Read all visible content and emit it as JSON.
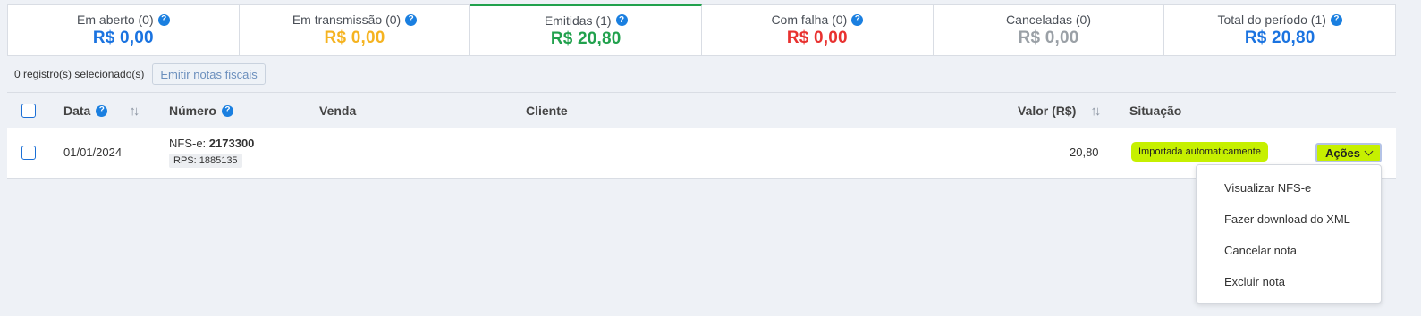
{
  "summary": {
    "cards": [
      {
        "label": "Em aberto (0)",
        "value": "R$ 0,00",
        "color": "#1a73e0",
        "help": true
      },
      {
        "label": "Em transmissão (0)",
        "value": "R$ 0,00",
        "color": "#f5b320",
        "help": true
      },
      {
        "label": "Emitidas (1)",
        "value": "R$ 20,80",
        "color": "#21a14d",
        "help": true
      },
      {
        "label": "Com falha (0)",
        "value": "R$ 0,00",
        "color": "#e8312f",
        "help": true
      },
      {
        "label": "Canceladas (0)",
        "value": "R$ 0,00",
        "color": "#9aa0a6",
        "help": false
      },
      {
        "label": "Total do período (1)",
        "value": "R$ 20,80",
        "color": "#1a73e0",
        "help": true
      }
    ]
  },
  "selection": {
    "count_text": "0 registro(s) selecionado(s)",
    "emit_button": "Emitir notas fiscais"
  },
  "table": {
    "headers": {
      "data": "Data",
      "numero": "Número",
      "venda": "Venda",
      "cliente": "Cliente",
      "valor": "Valor (R$)",
      "situacao": "Situação"
    },
    "rows": [
      {
        "data": "01/01/2024",
        "nfse_prefix": "NFS-e:",
        "nfse_number": "2173300",
        "rps": "RPS: 1885135",
        "venda": "",
        "cliente": "",
        "valor": "20,80",
        "situacao": "Importada automaticamente",
        "actions_label": "Ações"
      }
    ]
  },
  "actions_menu": {
    "items": [
      "Visualizar NFS-e",
      "Fazer download do XML",
      "Cancelar nota",
      "Excluir nota"
    ]
  },
  "colors": {
    "accent": "#1a73e0",
    "highlight": "#c6f000",
    "active_tab": "#21a14d"
  }
}
